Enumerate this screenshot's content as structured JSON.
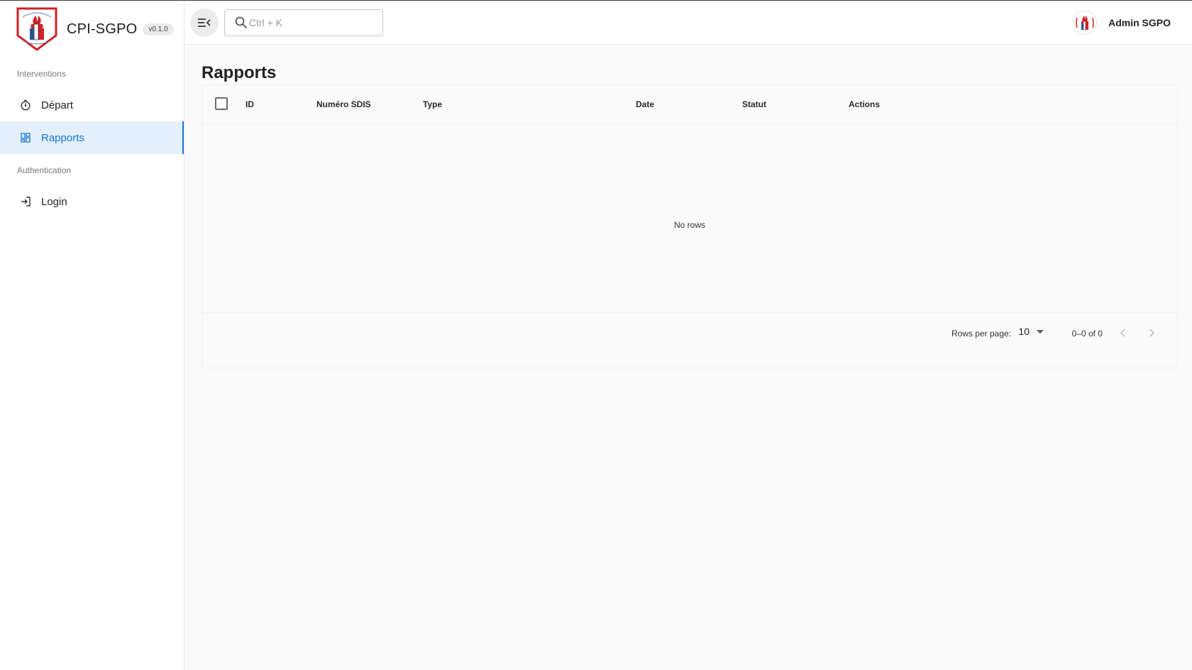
{
  "brand": {
    "title": "CPI-SGPO",
    "version": "v0.1.0",
    "logo_icon": "fire-department-crest-logo"
  },
  "sidebar": {
    "sections": [
      {
        "label": "Interventions",
        "items": [
          {
            "label": "Départ",
            "icon": "timer-icon",
            "active": false
          },
          {
            "label": "Rapports",
            "icon": "dashboard-icon",
            "active": true
          }
        ]
      },
      {
        "label": "Authentication",
        "items": [
          {
            "label": "Login",
            "icon": "login-icon",
            "active": false
          }
        ]
      }
    ]
  },
  "topbar": {
    "menu_toggle_icon": "menu-collapse-icon",
    "search": {
      "placeholder": "Ctrl + K",
      "value": "",
      "icon": "search-icon"
    },
    "user": {
      "name": "Admin SGPO",
      "avatar_icon": "crest-avatar"
    }
  },
  "main": {
    "title": "Rapports",
    "table": {
      "columns": [
        "ID",
        "Numéro SDIS",
        "Type",
        "Date",
        "Statut",
        "Actions"
      ],
      "rows": [],
      "empty_text": "No rows"
    },
    "pagination": {
      "rows_per_page_label": "Rows per page:",
      "rows_per_page": "10",
      "range": "0–0 of 0",
      "prev_icon": "chevron-left-icon",
      "next_icon": "chevron-right-icon"
    }
  },
  "colors": {
    "accent": "#1976d2",
    "active_bg": "#e3f0fb",
    "main_bg": "#fafafa"
  }
}
